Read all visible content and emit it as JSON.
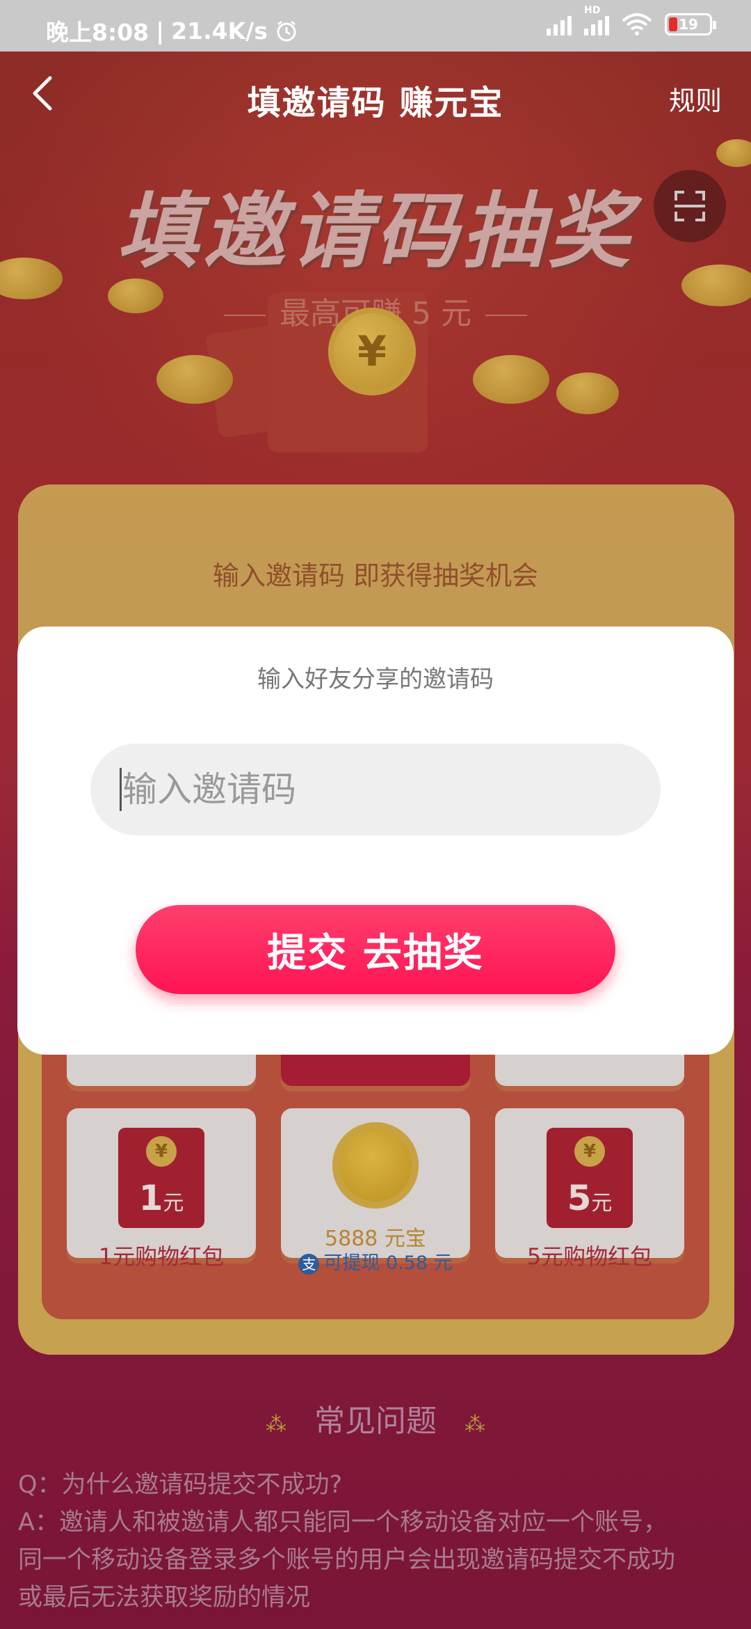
{
  "status_bar": {
    "time": "晚上8:08",
    "network_speed": "21.4K/s",
    "battery": "19",
    "network_type": "HD"
  },
  "header": {
    "title": "填邀请码 赚元宝",
    "rules": "规则"
  },
  "banner": {
    "title": "填邀请码抽奖",
    "subtitle": "最高可赚 5 元",
    "coin_symbol": "¥"
  },
  "card": {
    "headline": "输入邀请码 即获得抽奖机会"
  },
  "prizes": [
    {
      "amount": "1",
      "unit": "元",
      "label": "1元购物红包",
      "symbol": "¥"
    },
    {
      "label": "5888 元宝",
      "sub": "可提现 0.58 元",
      "sub_icon": "支"
    },
    {
      "amount": "5",
      "unit": "元",
      "label": "5元购物红包",
      "symbol": "¥"
    }
  ],
  "faq": {
    "title": "常见问题",
    "q": "Q：为什么邀请码提交不成功?",
    "a_lines": [
      "A：邀请人和被邀请人都只能同一个移动设备对应一个账号，",
      "同一个移动设备登录多个账号的用户会出现邀请码提交不成功",
      "或最后无法获取奖励的情况"
    ]
  },
  "dialog": {
    "title": "输入好友分享的邀请码",
    "input_placeholder": "输入邀请码",
    "input_value": "",
    "submit": "提交 去抽奖"
  },
  "colors": {
    "submit_button": "#ff1f5a",
    "dialog_bg": "#ffffff",
    "status_bar_bg": "#c9c9c9"
  }
}
